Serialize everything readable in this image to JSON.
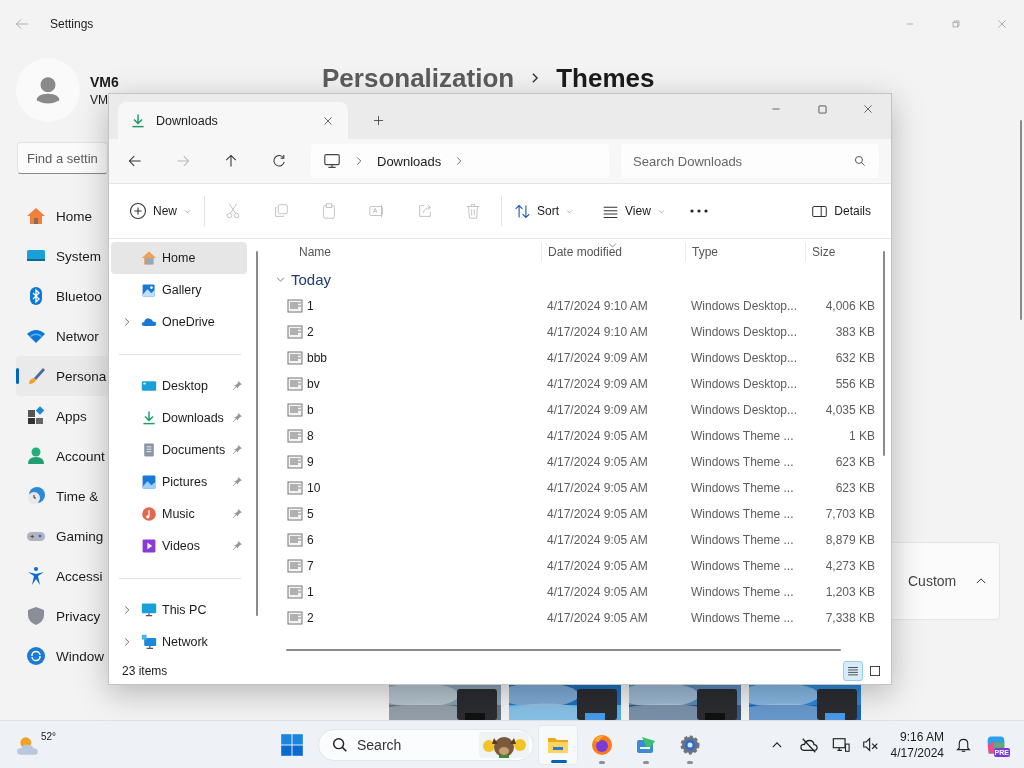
{
  "settings": {
    "title": "Settings",
    "user": {
      "name": "VM6",
      "account": "VM"
    },
    "search": {
      "placeholder": "Find a settin"
    },
    "nav": [
      {
        "label": "Home",
        "selected": false
      },
      {
        "label": "System",
        "selected": false
      },
      {
        "label": "Bluetoo",
        "selected": false
      },
      {
        "label": "Networ",
        "selected": false
      },
      {
        "label": "Persona",
        "selected": true
      },
      {
        "label": "Apps",
        "selected": false
      },
      {
        "label": "Account",
        "selected": false
      },
      {
        "label": "Time &",
        "selected": false
      },
      {
        "label": "Gaming",
        "selected": false
      },
      {
        "label": "Accessi",
        "selected": false
      },
      {
        "label": "Privacy",
        "selected": false
      },
      {
        "label": "Window",
        "selected": false
      }
    ],
    "breadcrumb": [
      "Personalization",
      "Themes"
    ],
    "theme_setting": {
      "value": "Custom",
      "expanded": true
    }
  },
  "explorer": {
    "tabs": [
      {
        "label": "Downloads",
        "selected": true
      }
    ],
    "nav_buttons": [
      {
        "kind": "back",
        "disabled": false
      },
      {
        "kind": "forward",
        "disabled": true
      },
      {
        "kind": "up",
        "disabled": false
      },
      {
        "kind": "refresh",
        "disabled": false
      }
    ],
    "address": [
      "Downloads"
    ],
    "search": {
      "placeholder": "Search Downloads"
    },
    "new": {
      "label": "New"
    },
    "edit_tools": [
      {
        "kind": "cut",
        "disabled": true
      },
      {
        "kind": "copy",
        "disabled": true
      },
      {
        "kind": "paste",
        "disabled": true
      },
      {
        "kind": "rename",
        "disabled": true
      },
      {
        "kind": "share",
        "disabled": true
      },
      {
        "kind": "delete",
        "disabled": true
      }
    ],
    "sort": {
      "label": "Sort"
    },
    "view": {
      "label": "View"
    },
    "details": {
      "label": "Details"
    },
    "nav_pane": [
      {
        "kind": "item",
        "label": "Home",
        "selected": true,
        "expandable": false,
        "pinned": false
      },
      {
        "kind": "item",
        "label": "Gallery",
        "selected": false,
        "expandable": false,
        "pinned": false
      },
      {
        "kind": "item",
        "label": "OneDrive",
        "selected": false,
        "expandable": true,
        "pinned": false
      },
      {
        "kind": "divider"
      },
      {
        "kind": "item",
        "label": "Desktop",
        "selected": false,
        "expandable": false,
        "pinned": true
      },
      {
        "kind": "item",
        "label": "Downloads",
        "selected": false,
        "expandable": false,
        "pinned": true
      },
      {
        "kind": "item",
        "label": "Documents",
        "selected": false,
        "expandable": false,
        "pinned": true
      },
      {
        "kind": "item",
        "label": "Pictures",
        "selected": false,
        "expandable": false,
        "pinned": true
      },
      {
        "kind": "item",
        "label": "Music",
        "selected": false,
        "expandable": false,
        "pinned": true
      },
      {
        "kind": "item",
        "label": "Videos",
        "selected": false,
        "expandable": false,
        "pinned": true
      },
      {
        "kind": "divider"
      },
      {
        "kind": "item",
        "label": "This PC",
        "selected": false,
        "expandable": true,
        "pinned": false
      },
      {
        "kind": "item",
        "label": "Network",
        "selected": false,
        "expandable": true,
        "pinned": false
      }
    ],
    "columns": [
      {
        "label": "Name",
        "sorted": false
      },
      {
        "label": "Date modified",
        "sorted": true
      },
      {
        "label": "Type",
        "sorted": false
      },
      {
        "label": "Size",
        "sorted": false
      }
    ],
    "groups": [
      {
        "label": "Today",
        "expanded": true,
        "rows": [
          {
            "name": "1",
            "date": "4/17/2024 9:10 AM",
            "type": "Windows Desktop...",
            "size": "4,006 KB"
          },
          {
            "name": "2",
            "date": "4/17/2024 9:10 AM",
            "type": "Windows Desktop...",
            "size": "383 KB"
          },
          {
            "name": "bbb",
            "date": "4/17/2024 9:09 AM",
            "type": "Windows Desktop...",
            "size": "632 KB"
          },
          {
            "name": "bv",
            "date": "4/17/2024 9:09 AM",
            "type": "Windows Desktop...",
            "size": "556 KB"
          },
          {
            "name": "b",
            "date": "4/17/2024 9:09 AM",
            "type": "Windows Desktop...",
            "size": "4,035 KB"
          },
          {
            "name": "8",
            "date": "4/17/2024 9:05 AM",
            "type": "Windows Theme ...",
            "size": "1 KB"
          },
          {
            "name": "9",
            "date": "4/17/2024 9:05 AM",
            "type": "Windows Theme ...",
            "size": "623 KB"
          },
          {
            "name": "10",
            "date": "4/17/2024 9:05 AM",
            "type": "Windows Theme ...",
            "size": "623 KB"
          },
          {
            "name": "5",
            "date": "4/17/2024 9:05 AM",
            "type": "Windows Theme ...",
            "size": "7,703 KB"
          },
          {
            "name": "6",
            "date": "4/17/2024 9:05 AM",
            "type": "Windows Theme ...",
            "size": "8,879 KB"
          },
          {
            "name": "7",
            "date": "4/17/2024 9:05 AM",
            "type": "Windows Theme ...",
            "size": "4,273 KB"
          },
          {
            "name": "1",
            "date": "4/17/2024 9:05 AM",
            "type": "Windows Theme ...",
            "size": "1,203 KB"
          },
          {
            "name": "2",
            "date": "4/17/2024 9:05 AM",
            "type": "Windows Theme ...",
            "size": "7,338 KB"
          }
        ]
      }
    ],
    "status": "23 items",
    "view_modes": [
      {
        "kind": "details",
        "selected": true
      },
      {
        "kind": "tiles",
        "selected": false
      }
    ]
  },
  "taskbar": {
    "weather": {
      "temperature": "52°"
    },
    "search": {
      "placeholder": "Search"
    },
    "apps": [
      {
        "kind": "folder",
        "running": true,
        "selected": true
      },
      {
        "kind": "browser",
        "running": true,
        "selected": false
      },
      {
        "kind": "app",
        "running": true,
        "selected": false
      },
      {
        "kind": "gear",
        "running": true,
        "selected": false
      }
    ],
    "clock": {
      "time": "9:16 AM",
      "date": "4/17/2024"
    },
    "copilot": {
      "badge": "PRE"
    }
  }
}
